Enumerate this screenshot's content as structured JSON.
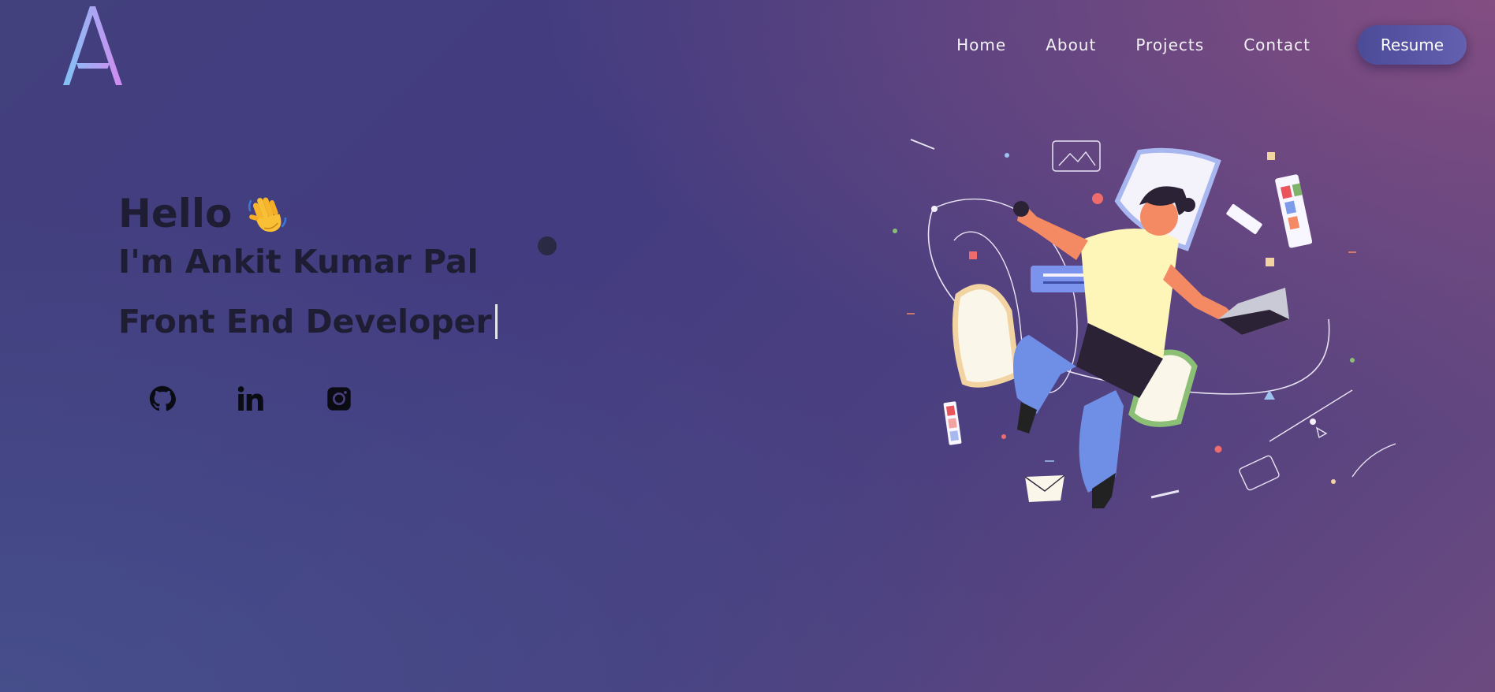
{
  "logo": {
    "letter": "A"
  },
  "nav": {
    "items": [
      "Home",
      "About",
      "Projects",
      "Contact"
    ],
    "resume_label": "Resume"
  },
  "hero": {
    "greeting": "Hello",
    "wave_icon": "waving-hand",
    "name_line": "I'm Ankit Kumar Pal",
    "role_text": "Front End Developer"
  },
  "socials": [
    {
      "icon": "github-icon"
    },
    {
      "icon": "linkedin-icon"
    },
    {
      "icon": "instagram-icon"
    }
  ],
  "colors": {
    "background_start": "#43407e",
    "background_end": "#6c4a80",
    "accent": "#6360b0",
    "text_dark": "#1e1d33",
    "nav_text": "#f2f2f7"
  }
}
